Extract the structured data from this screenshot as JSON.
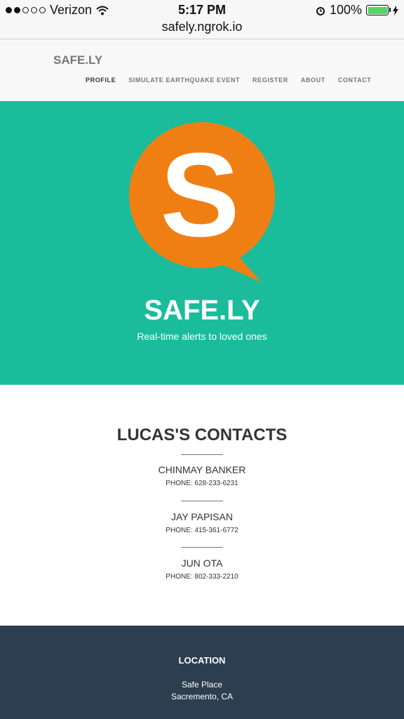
{
  "status_bar": {
    "carrier": "Verizon",
    "time": "5:17 PM",
    "battery": "100%"
  },
  "browser": {
    "url": "safely.ngrok.io"
  },
  "nav": {
    "brand": "SAFE.LY",
    "items": [
      "PROFILE",
      "SIMULATE EARTHQUAKE EVENT",
      "REGISTER",
      "ABOUT",
      "CONTACT"
    ]
  },
  "hero": {
    "logo_letter": "S",
    "title": "SAFE.LY",
    "tagline": "Real-time alerts to loved ones",
    "colors": {
      "bg": "#1abc9c",
      "logo": "#f07f13"
    }
  },
  "contacts": {
    "title": "LUCAS'S CONTACTS",
    "items": [
      {
        "name": "CHINMAY BANKER",
        "phone": "PHONE: 628-233-6231"
      },
      {
        "name": "JAY PAPISAN",
        "phone": "PHONE: 415-361-6772"
      },
      {
        "name": "JUN OTA",
        "phone": "PHONE: 802-333-2210"
      }
    ]
  },
  "footer": {
    "heading": "LOCATION",
    "line1": "Safe Place",
    "line2": "Sacremento, CA",
    "colors": {
      "bg": "#2c3e50"
    }
  }
}
